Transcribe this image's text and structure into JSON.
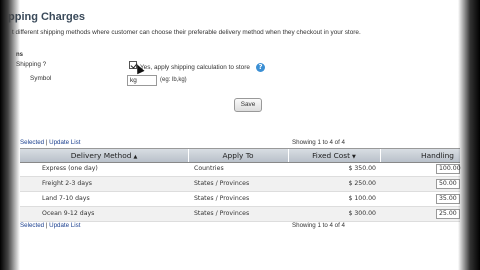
{
  "page": {
    "title": "pping Charges",
    "subtitle": "t different shipping methods where customer can choose their preferable delivery method when they checkout in your store."
  },
  "settings": {
    "section_label": "ns",
    "enable_label": "Shipping ?",
    "enable_text": "Yes, apply shipping calculation to store",
    "enable_checked": true,
    "symbol_label": "Symbol",
    "symbol_value": "kg",
    "symbol_hint": "(eg: lb,kg)",
    "save_label": "Save"
  },
  "list_top": {
    "selected_link": "Selected",
    "separator": " | ",
    "update_link": "Update List",
    "showing": "Showing 1 to 4 of 4"
  },
  "table": {
    "headers": {
      "delivery_method": "Delivery Method",
      "apply_to": "Apply To",
      "fixed_cost": "Fixed Cost",
      "handling": "Handling"
    },
    "rows": [
      {
        "method": "Express (one day)",
        "apply_to": "Countries",
        "fixed_cost": "$ 350.00",
        "handling": "100.00"
      },
      {
        "method": "Freight 2-3 days",
        "apply_to": "States / Provinces",
        "fixed_cost": "$ 250.00",
        "handling": "50.00"
      },
      {
        "method": "Land 7-10 days",
        "apply_to": "States / Provinces",
        "fixed_cost": "$ 100.00",
        "handling": "35.00"
      },
      {
        "method": "Ocean 9-12 days",
        "apply_to": "States / Provinces",
        "fixed_cost": "$ 300.00",
        "handling": "25.00"
      }
    ]
  },
  "list_bottom": {
    "selected_link": "Selected",
    "separator": " | ",
    "update_link": "Update List",
    "showing": "Showing 1 to 4 of 4"
  },
  "icons": {
    "help": "help-icon",
    "sort": "sort-arrow-icon",
    "cursor": "mouse-cursor-icon"
  }
}
